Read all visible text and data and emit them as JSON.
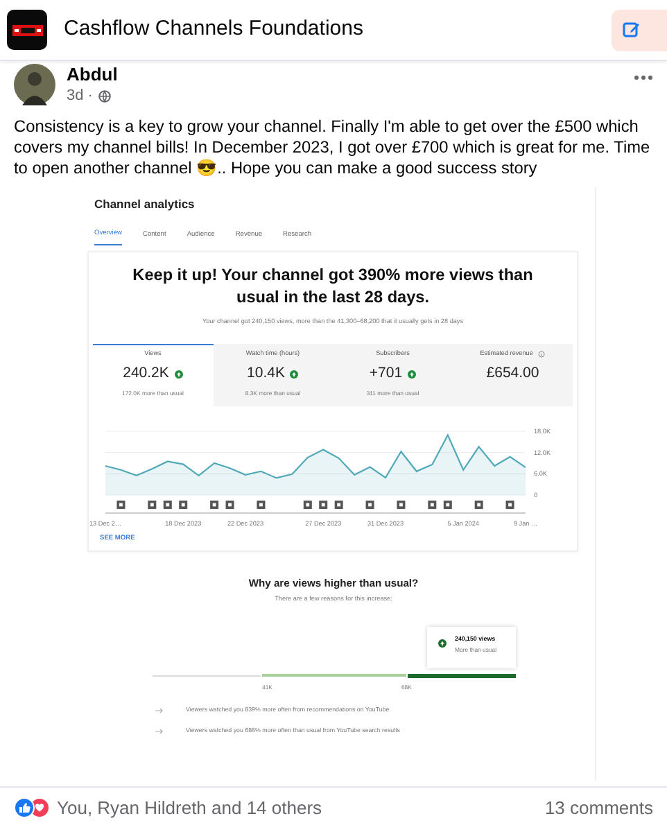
{
  "group": {
    "name": "Cashflow Channels Foundations"
  },
  "post": {
    "author": "Abdul",
    "time": "3d ·",
    "text": "Consistency is a key to grow your channel. Finally I'm able to get over the £500 which covers my channel bills! In December 2023, I got over £700 which is great for me. Time to open another channel 😎.. Hope you can make a good success story"
  },
  "analytics": {
    "title": "Channel analytics",
    "tabs": [
      {
        "label": "Overview",
        "selected": true
      },
      {
        "label": "Content",
        "selected": false
      },
      {
        "label": "Audience",
        "selected": false
      },
      {
        "label": "Revenue",
        "selected": false
      },
      {
        "label": "Research",
        "selected": false
      }
    ],
    "headline": "Keep it up! Your channel got 390% more views than usual in the last 28 days.",
    "summary": "Your channel got 240,150 views, more than the 41,300–68,200 that it usually gets in 28 days",
    "metrics": [
      {
        "label": "Views",
        "value": "240.2K",
        "note": "172.0K more than usual",
        "selected": true,
        "trend_up": true,
        "info": false
      },
      {
        "label": "Watch time (hours)",
        "value": "10.4K",
        "note": "8.3K more than usual",
        "selected": false,
        "trend_up": true,
        "info": false
      },
      {
        "label": "Subscribers",
        "value": "+701",
        "note": "311 more than usual",
        "selected": false,
        "trend_up": true,
        "info": false
      },
      {
        "label": "Estimated revenue",
        "value": "£654.00",
        "selected": false,
        "trend_up": false,
        "info": true
      }
    ],
    "chart_data": {
      "type": "area",
      "categories": [
        "13 Dec 2…",
        null,
        null,
        null,
        null,
        "18 Dec 2023",
        null,
        null,
        null,
        "22 Dec 2023",
        null,
        null,
        null,
        null,
        "27 Dec 2023",
        null,
        null,
        null,
        "31 Dec 2023",
        null,
        null,
        null,
        null,
        "5 Jan 2024",
        null,
        null,
        null,
        "9 Jan …"
      ],
      "series": [
        {
          "color": "#4fa9b8",
          "values": [
            8200,
            7100,
            5500,
            7400,
            9500,
            8700,
            5500,
            9000,
            7600,
            5700,
            6700,
            4800,
            5900,
            10600,
            12800,
            10400,
            5700,
            7900,
            4900,
            12300,
            6700,
            8600,
            16900,
            7100,
            13600,
            8200,
            10800,
            7800
          ]
        }
      ],
      "ylim": [
        0,
        18000
      ],
      "yticks": [
        {
          "value": 0,
          "label": "0"
        },
        {
          "value": 6000,
          "label": "6.0K"
        },
        {
          "value": 12000,
          "label": "12.0K"
        },
        {
          "value": 18000,
          "label": "18.0K"
        }
      ]
    },
    "video_days": [
      false,
      true,
      false,
      true,
      true,
      true,
      false,
      true,
      true,
      false,
      true,
      false,
      false,
      true,
      true,
      true,
      false,
      true,
      false,
      true,
      false,
      true,
      true,
      false,
      true,
      false,
      true,
      false
    ],
    "see_more": "SEE MORE",
    "reasons_title": "Why are views higher than usual?",
    "reasons_subtitle": "There are a few reasons for this increase:",
    "callout": {
      "value": "240,150 views",
      "note": "More than usual"
    },
    "range_labels": [
      "41K",
      "68K"
    ],
    "reasons": [
      "Viewers watched you 839% more often from recommendations on YouTube",
      "Viewers watched you 686% more often than usual from YouTube search results"
    ]
  },
  "reactions": {
    "summary": "You, Ryan Hildreth and 14 others",
    "comments": "13 comments"
  }
}
